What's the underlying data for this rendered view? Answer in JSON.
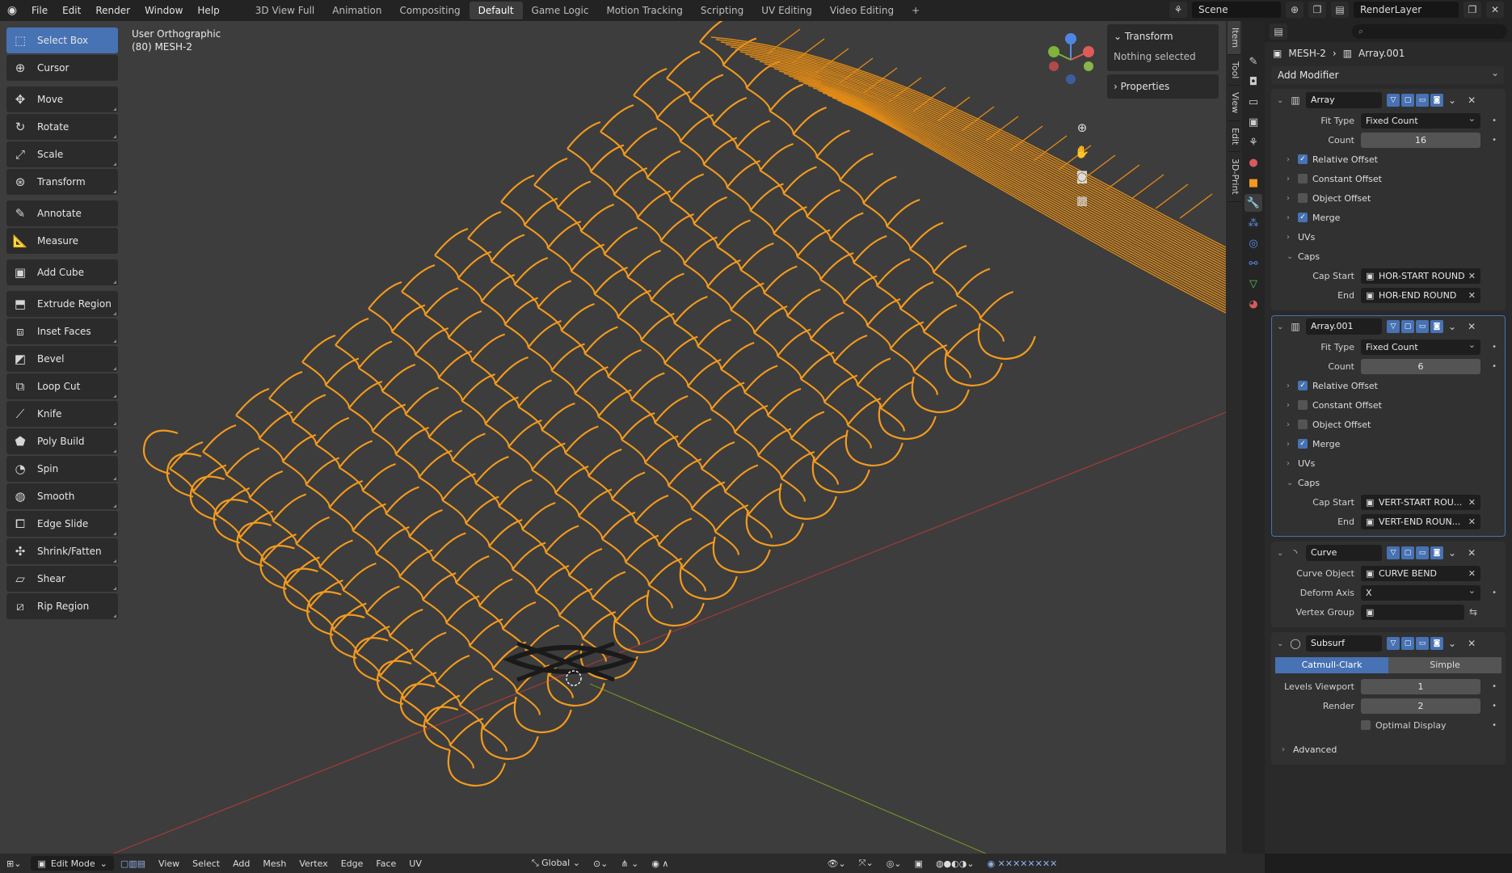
{
  "topbar": {
    "menus": [
      "File",
      "Edit",
      "Render",
      "Window",
      "Help"
    ],
    "workspaces": [
      "3D View Full",
      "Animation",
      "Compositing",
      "Default",
      "Game Logic",
      "Motion Tracking",
      "Scripting",
      "UV Editing",
      "Video Editing"
    ],
    "active_workspace": "Default",
    "scene": "Scene",
    "render_layer": "RenderLayer"
  },
  "viewport": {
    "view_name": "User Orthographic",
    "object_info": "(80) MESH-2"
  },
  "toolbar": {
    "tools": [
      {
        "label": "Select Box",
        "icon": "select-box-icon",
        "active": true
      },
      {
        "label": "Cursor",
        "icon": "cursor-icon"
      },
      {
        "label": "Move",
        "icon": "move-icon"
      },
      {
        "label": "Rotate",
        "icon": "rotate-icon"
      },
      {
        "label": "Scale",
        "icon": "scale-icon"
      },
      {
        "label": "Transform",
        "icon": "transform-icon"
      },
      {
        "label": "Annotate",
        "icon": "annotate-icon"
      },
      {
        "label": "Measure",
        "icon": "measure-icon"
      },
      {
        "label": "Add Cube",
        "icon": "add-cube-icon"
      },
      {
        "label": "Extrude Region",
        "icon": "extrude-icon"
      },
      {
        "label": "Inset Faces",
        "icon": "inset-icon"
      },
      {
        "label": "Bevel",
        "icon": "bevel-icon"
      },
      {
        "label": "Loop Cut",
        "icon": "loop-cut-icon"
      },
      {
        "label": "Knife",
        "icon": "knife-icon"
      },
      {
        "label": "Poly Build",
        "icon": "poly-build-icon"
      },
      {
        "label": "Spin",
        "icon": "spin-icon"
      },
      {
        "label": "Smooth",
        "icon": "smooth-icon"
      },
      {
        "label": "Edge Slide",
        "icon": "edge-slide-icon"
      },
      {
        "label": "Shrink/Fatten",
        "icon": "shrink-fatten-icon"
      },
      {
        "label": "Shear",
        "icon": "shear-icon"
      },
      {
        "label": "Rip Region",
        "icon": "rip-region-icon"
      }
    ]
  },
  "npanel": {
    "transform_label": "Transform",
    "nothing_selected": "Nothing selected",
    "properties_label": "Properties",
    "tabs": [
      "Item",
      "Tool",
      "View",
      "Edit",
      "3D-Print"
    ]
  },
  "properties": {
    "object": "MESH-2",
    "modifier_ref": "Array.001",
    "add_modifier": "Add Modifier",
    "array1": {
      "name": "Array",
      "fit_type_label": "Fit Type",
      "fit_type": "Fixed Count",
      "count_label": "Count",
      "count": "16",
      "relative_offset": "Relative Offset",
      "constant_offset": "Constant Offset",
      "object_offset": "Object Offset",
      "merge": "Merge",
      "uvs": "UVs",
      "caps": "Caps",
      "cap_start_label": "Cap Start",
      "cap_start": "HOR-START ROUND",
      "end_label": "End",
      "end": "HOR-END ROUND"
    },
    "array2": {
      "name": "Array.001",
      "fit_type_label": "Fit Type",
      "fit_type": "Fixed Count",
      "count_label": "Count",
      "count": "6",
      "relative_offset": "Relative Offset",
      "constant_offset": "Constant Offset",
      "object_offset": "Object Offset",
      "merge": "Merge",
      "uvs": "UVs",
      "caps": "Caps",
      "cap_start_label": "Cap Start",
      "cap_start": "VERT-START ROU...",
      "end_label": "End",
      "end": "VERT-END ROUN..."
    },
    "curve": {
      "name": "Curve",
      "curve_object_label": "Curve Object",
      "curve_object": "CURVE BEND",
      "deform_axis_label": "Deform Axis",
      "deform_axis": "X",
      "vertex_group_label": "Vertex Group"
    },
    "subsurf": {
      "name": "Subsurf",
      "catmull": "Catmull-Clark",
      "simple": "Simple",
      "levels_label": "Levels Viewport",
      "levels": "1",
      "render_label": "Render",
      "render": "2",
      "optimal": "Optimal Display",
      "advanced": "Advanced"
    }
  },
  "statusbar": {
    "mode": "Edit Mode",
    "menus": [
      "View",
      "Select",
      "Add",
      "Mesh",
      "Vertex",
      "Edge",
      "Face",
      "UV"
    ],
    "orientation": "Global"
  },
  "colors": {
    "accent": "#4772b3",
    "wire": "#f39a1e",
    "viewport_bg": "#3d3d3d"
  }
}
